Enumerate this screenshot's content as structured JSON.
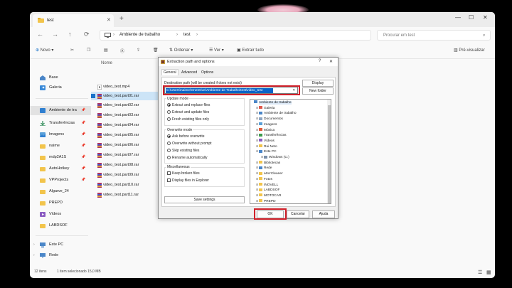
{
  "explorer": {
    "tab_title": "test",
    "breadcrumb": [
      "Ambiente de trabalho",
      "test"
    ],
    "search_placeholder": "Procurar em test",
    "toolbar": {
      "new": "Novo",
      "sort": "Ordenar",
      "view": "Ver",
      "extract": "Extrair tudo",
      "preview": "Pré-visualizar"
    },
    "sidebar": [
      {
        "label": "Base",
        "icon": "home-icon"
      },
      {
        "label": "Galeria",
        "icon": "gallery-icon"
      },
      {
        "label": "Ambiente de tra",
        "icon": "desktop-icon",
        "pinned": true,
        "selected": true
      },
      {
        "label": "Transferências",
        "icon": "download-icon",
        "pinned": true
      },
      {
        "label": "Imagens",
        "icon": "pictures-icon",
        "pinned": true
      },
      {
        "label": "naime",
        "icon": "folder-icon",
        "pinned": true
      },
      {
        "label": "mdp2A1S",
        "icon": "folder-icon",
        "pinned": true
      },
      {
        "label": "AutoHotkey",
        "icon": "folder-icon",
        "pinned": true
      },
      {
        "label": "VPProjects",
        "icon": "folder-icon",
        "pinned": true
      },
      {
        "label": "Algarve_24",
        "icon": "folder-icon"
      },
      {
        "label": "PREPD",
        "icon": "folder-icon"
      },
      {
        "label": "Vídeos",
        "icon": "videos-icon"
      },
      {
        "label": "LABDSOF",
        "icon": "folder-icon"
      }
    ],
    "sidebar_bottom": [
      {
        "label": "Este PC",
        "icon": "pc-icon"
      },
      {
        "label": "Rede",
        "icon": "network-icon"
      }
    ],
    "column_name": "Nome",
    "files": [
      {
        "name": "video_test.mp4",
        "selected": false
      },
      {
        "name": "video_test.part01.rar",
        "selected": true
      },
      {
        "name": "video_test.part02.rar",
        "selected": false
      },
      {
        "name": "video_test.part03.rar",
        "selected": false
      },
      {
        "name": "video_test.part04.rar",
        "selected": false
      },
      {
        "name": "video_test.part05.rar",
        "selected": false
      },
      {
        "name": "video_test.part06.rar",
        "selected": false
      },
      {
        "name": "video_test.part07.rar",
        "selected": false
      },
      {
        "name": "video_test.part08.rar",
        "selected": false
      },
      {
        "name": "video_test.part09.rar",
        "selected": false
      },
      {
        "name": "video_test.part10.rar",
        "selected": false
      },
      {
        "name": "video_test.part11.rar",
        "selected": false
      }
    ],
    "status": {
      "count": "12 itens",
      "selection": "1 item selecionado 15,0 MB"
    }
  },
  "dialog": {
    "title": "Extraction path and options",
    "tabs": [
      "General",
      "Advanced",
      "Options"
    ],
    "dest_label": "Destination path (will be created if does not exist)",
    "dest_value": "C:\\Users\\naime\\OneDrive\\Ambiente de Trabalho\\test\\video_test",
    "display_button": "Display",
    "new_folder_button": "New folder",
    "update_mode": {
      "title": "Update mode",
      "options": [
        "Extract and replace files",
        "Extract and update files",
        "Fresh existing files only"
      ],
      "selected": 0
    },
    "overwrite_mode": {
      "title": "Overwrite mode",
      "options": [
        "Ask before overwrite",
        "Overwrite without prompt",
        "Skip existing files",
        "Rename automatically"
      ],
      "selected": 0
    },
    "misc": {
      "title": "Miscellaneous",
      "options": [
        "Keep broken files",
        "Display files in Explorer"
      ]
    },
    "save_settings": "Save settings",
    "tree": [
      {
        "label": "Ambiente de trabalho",
        "level": 0,
        "icon": "desktop-icon",
        "color": "#4a86c8"
      },
      {
        "label": "Galeria",
        "level": 1,
        "icon": "gallery-icon",
        "color": "#e0584b"
      },
      {
        "label": "Ambiente de trabalho",
        "level": 1,
        "icon": "desktop-icon",
        "color": "#4a86c8"
      },
      {
        "label": "Documentos",
        "level": 1,
        "icon": "documents-icon",
        "color": "#8fa6c2"
      },
      {
        "label": "Imagens",
        "level": 1,
        "icon": "pictures-icon",
        "color": "#5aa0d8"
      },
      {
        "label": "Música",
        "level": 1,
        "icon": "music-icon",
        "color": "#e05b3a"
      },
      {
        "label": "Transferências",
        "level": 1,
        "icon": "download-icon",
        "color": "#3c9a4c"
      },
      {
        "label": "Vídeos",
        "level": 1,
        "icon": "videos-icon",
        "color": "#8b5cc2"
      },
      {
        "label": "Rui Neto",
        "level": 1,
        "icon": "user-icon",
        "color": "#f2c44b"
      },
      {
        "label": "Este PC",
        "level": 1,
        "icon": "pc-icon",
        "color": "#4a86c8"
      },
      {
        "label": "Windows (C:)",
        "level": 2,
        "icon": "drive-icon",
        "color": "#7a8fa8"
      },
      {
        "label": "Bibliotecas",
        "level": 1,
        "icon": "library-icon",
        "color": "#f2c44b"
      },
      {
        "label": "Rede",
        "level": 1,
        "icon": "network-icon",
        "color": "#4a86c8"
      },
      {
        "label": "aScrCleaner",
        "level": 1,
        "icon": "folder-icon",
        "color": "#f2c44b"
      },
      {
        "label": "Fotos",
        "level": 1,
        "icon": "folder-icon",
        "color": "#f2c44b"
      },
      {
        "label": "INOVELL",
        "level": 1,
        "icon": "folder-icon",
        "color": "#f2c44b"
      },
      {
        "label": "LABDSOF",
        "level": 1,
        "icon": "folder-icon",
        "color": "#f2c44b"
      },
      {
        "label": "MOTOCAR",
        "level": 1,
        "icon": "folder-icon",
        "color": "#f2c44b"
      },
      {
        "label": "PREPD",
        "level": 1,
        "icon": "folder-icon",
        "color": "#f2c44b"
      }
    ],
    "ok": "OK",
    "cancel": "Cancelar",
    "help": "Ajuda"
  },
  "colors": {
    "highlight": "#d0202a",
    "selection": "#0a64c8",
    "folder": "#f2c44b"
  }
}
